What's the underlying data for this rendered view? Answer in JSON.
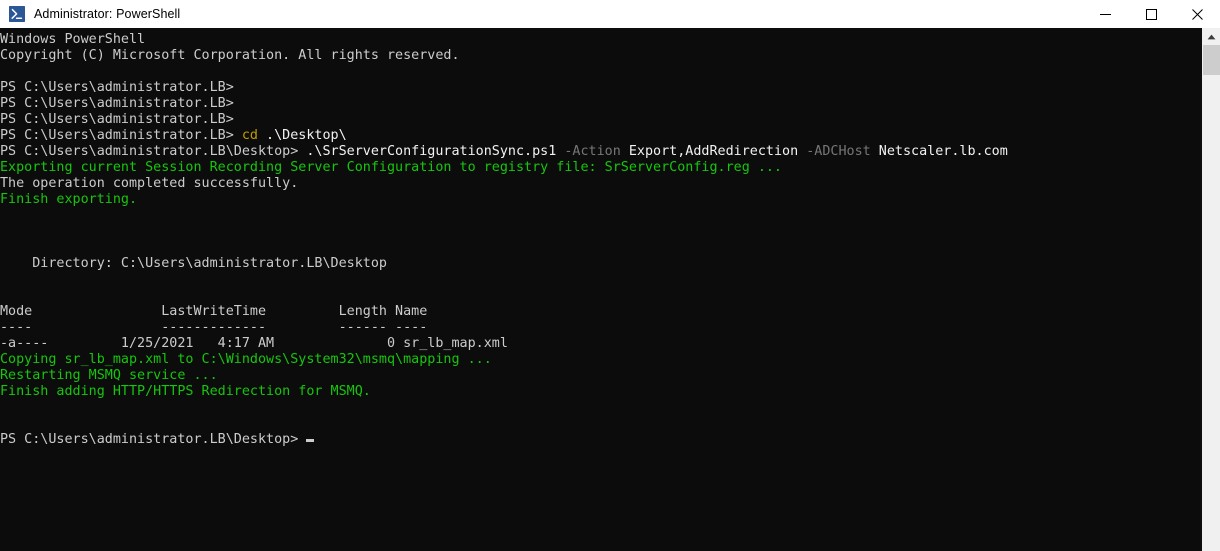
{
  "window": {
    "title": "Administrator: PowerShell",
    "icon": "powershell-icon",
    "background_color": "#0C0C0C",
    "titlebar_color": "#FFFFFF",
    "controls": {
      "minimize": "—",
      "maximize": "□",
      "close": "✕"
    }
  },
  "colors": {
    "foreground": "#CCCCCC",
    "green": "#16C60C",
    "yellow": "#C19C00",
    "gray": "#767676",
    "background": "#0C0C0C"
  },
  "terminal": {
    "prompt_home": "PS C:\\Users\\administrator.LB>",
    "prompt_desktop": "PS C:\\Users\\administrator.LB\\Desktop>",
    "lines": [
      {
        "id": "banner-1",
        "segments": [
          {
            "text": "Windows PowerShell",
            "color": "white"
          }
        ]
      },
      {
        "id": "banner-2",
        "segments": [
          {
            "text": "Copyright (C) Microsoft Corporation. All rights reserved.",
            "color": "white"
          }
        ]
      },
      {
        "id": "blank-1",
        "segments": [
          {
            "text": "",
            "color": "white"
          }
        ]
      },
      {
        "id": "prompt-1",
        "segments": [
          {
            "text": "PS C:\\Users\\administrator.LB>",
            "color": "white"
          }
        ]
      },
      {
        "id": "prompt-2",
        "segments": [
          {
            "text": "PS C:\\Users\\administrator.LB>",
            "color": "white"
          }
        ]
      },
      {
        "id": "prompt-3",
        "segments": [
          {
            "text": "PS C:\\Users\\administrator.LB>",
            "color": "white"
          }
        ]
      },
      {
        "id": "cmd-cd",
        "segments": [
          {
            "text": "PS C:\\Users\\administrator.LB> ",
            "color": "white"
          },
          {
            "text": "cd",
            "color": "yellow"
          },
          {
            "text": " .\\Desktop\\",
            "color": "bright"
          }
        ]
      },
      {
        "id": "cmd-script",
        "segments": [
          {
            "text": "PS C:\\Users\\administrator.LB\\Desktop> ",
            "color": "white"
          },
          {
            "text": ".\\SrServerConfigurationSync.ps1",
            "color": "bright"
          },
          {
            "text": " -Action",
            "color": "gray"
          },
          {
            "text": " Export,AddRedirection",
            "color": "bright"
          },
          {
            "text": " -ADCHost",
            "color": "gray"
          },
          {
            "text": " Netscaler.lb.com",
            "color": "bright"
          }
        ]
      },
      {
        "id": "out-exporting",
        "segments": [
          {
            "text": "Exporting current Session Recording Server Configuration to registry file: SrServerConfig.reg ...",
            "color": "green"
          }
        ]
      },
      {
        "id": "out-operation-ok",
        "segments": [
          {
            "text": "The operation completed successfully.",
            "color": "white"
          }
        ]
      },
      {
        "id": "out-finish-export",
        "segments": [
          {
            "text": "Finish exporting.",
            "color": "green"
          }
        ]
      },
      {
        "id": "blank-2",
        "segments": [
          {
            "text": "",
            "color": "white"
          }
        ]
      },
      {
        "id": "blank-3",
        "segments": [
          {
            "text": "",
            "color": "white"
          }
        ]
      },
      {
        "id": "blank-4",
        "segments": [
          {
            "text": "",
            "color": "white"
          }
        ]
      },
      {
        "id": "dir-header",
        "segments": [
          {
            "text": "    Directory: C:\\Users\\administrator.LB\\Desktop",
            "color": "white"
          }
        ]
      },
      {
        "id": "blank-5",
        "segments": [
          {
            "text": "",
            "color": "white"
          }
        ]
      },
      {
        "id": "blank-6",
        "segments": [
          {
            "text": "",
            "color": "white"
          }
        ]
      },
      {
        "id": "table-head",
        "segments": [
          {
            "text": "Mode                LastWriteTime         Length Name",
            "color": "white"
          }
        ]
      },
      {
        "id": "table-rule",
        "segments": [
          {
            "text": "----                -------------         ------ ----",
            "color": "white"
          }
        ]
      },
      {
        "id": "table-row-1",
        "segments": [
          {
            "text": "-a----         1/25/2021   4:17 AM              0 sr_lb_map.xml",
            "color": "white"
          }
        ]
      },
      {
        "id": "out-copying",
        "segments": [
          {
            "text": "Copying sr_lb_map.xml to C:\\Windows\\System32\\msmq\\mapping ...",
            "color": "green"
          }
        ]
      },
      {
        "id": "out-restarting",
        "segments": [
          {
            "text": "Restarting MSMQ service ...",
            "color": "green"
          }
        ]
      },
      {
        "id": "out-finish-redirect",
        "segments": [
          {
            "text": "Finish adding HTTP/HTTPS Redirection for MSMQ.",
            "color": "green"
          }
        ]
      },
      {
        "id": "blank-7",
        "segments": [
          {
            "text": "",
            "color": "white"
          }
        ]
      },
      {
        "id": "blank-8",
        "segments": [
          {
            "text": "",
            "color": "white"
          }
        ]
      },
      {
        "id": "prompt-final",
        "segments": [
          {
            "text": "PS C:\\Users\\administrator.LB\\Desktop> ",
            "color": "white"
          }
        ],
        "cursor": true
      }
    ]
  },
  "table": {
    "columns": [
      "Mode",
      "LastWriteTime",
      "Length",
      "Name"
    ],
    "rows": [
      {
        "Mode": "-a----",
        "LastWriteTime": "1/25/2021   4:17 AM",
        "Length": "0",
        "Name": "sr_lb_map.xml"
      }
    ]
  },
  "scrollbar": {
    "up_arrow": "▲",
    "thumb_top": 0,
    "thumb_height": 30
  }
}
